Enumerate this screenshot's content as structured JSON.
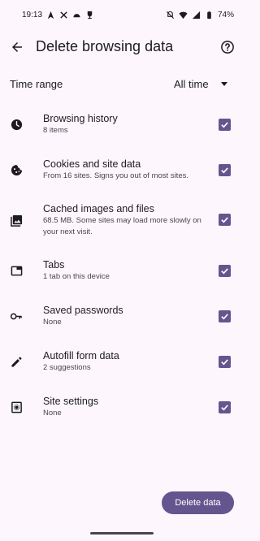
{
  "status_bar": {
    "time": "19:13",
    "battery": "74%",
    "left_icons": [
      "navigation-icon",
      "tools-icon",
      "android-icon",
      "trophy-icon"
    ],
    "right_icons": [
      "mute-icon",
      "wifi-icon",
      "signal-icon",
      "battery-icon"
    ]
  },
  "header": {
    "title": "Delete browsing data",
    "back_icon": "arrow-back-icon",
    "help_icon": "help-icon"
  },
  "time_range": {
    "label": "Time range",
    "value": "All time"
  },
  "items": [
    {
      "title": "Browsing history",
      "subtitle": "8 items",
      "icon": "history-icon",
      "checked": true
    },
    {
      "title": "Cookies and site data",
      "subtitle": "From 16 sites. Signs you out of most sites.",
      "icon": "cookie-icon",
      "checked": true
    },
    {
      "title": "Cached images and files",
      "subtitle": "68.5 MB. Some sites may load more slowly on your next visit.",
      "icon": "image-icon",
      "checked": true
    },
    {
      "title": "Tabs",
      "subtitle": "1 tab on this device",
      "icon": "tab-icon",
      "checked": true
    },
    {
      "title": "Saved passwords",
      "subtitle": "None",
      "icon": "key-icon",
      "checked": true
    },
    {
      "title": "Autofill form data",
      "subtitle": "2 suggestions",
      "icon": "pencil-icon",
      "checked": true
    },
    {
      "title": "Site settings",
      "subtitle": "None",
      "icon": "site-settings-icon",
      "checked": true
    }
  ],
  "actions": {
    "delete_label": "Delete data"
  },
  "colors": {
    "background": "#fdf7fd",
    "accent": "#65558f",
    "text": "#1d1b20",
    "subtext": "#49454f"
  }
}
